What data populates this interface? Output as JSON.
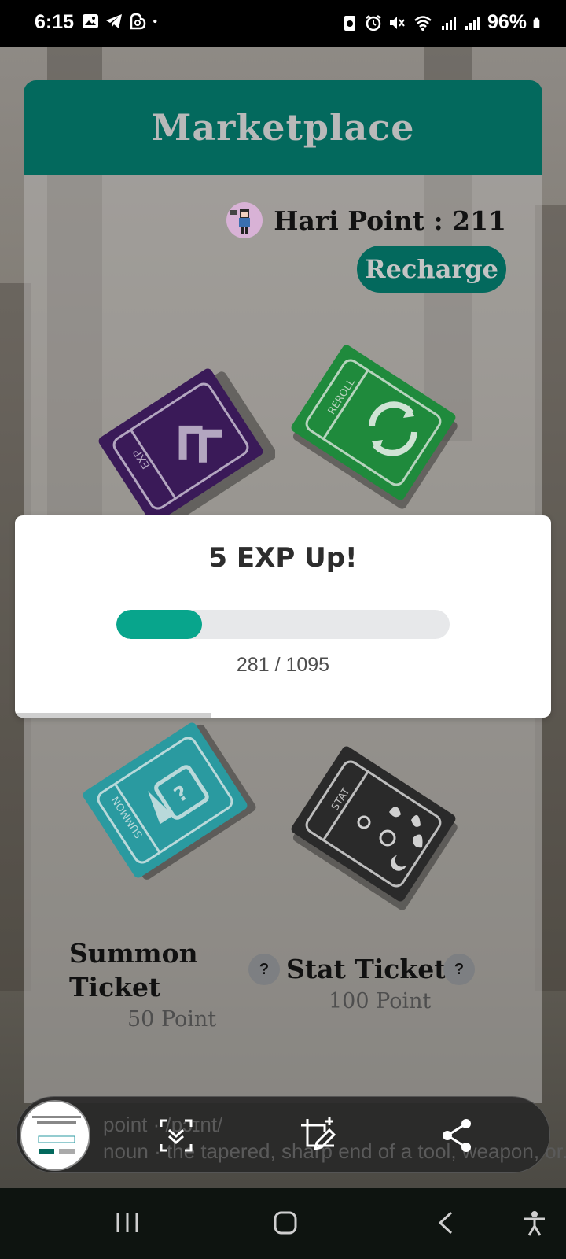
{
  "status_bar": {
    "time": "6:15",
    "battery": "96%"
  },
  "marketplace": {
    "title": "Marketplace",
    "points_label": "Hari Point : 211",
    "recharge_label": "Recharge"
  },
  "tickets": [
    {
      "type": "EXP",
      "color": "#3a1a58"
    },
    {
      "type": "REROLL",
      "color": "#1f8a3c"
    },
    {
      "type": "SUMMON",
      "color": "#2a9aa0",
      "name": "Summon Ticket",
      "name_line1": "Summon",
      "name_line2": "Ticket",
      "price": "50 Point"
    },
    {
      "type": "STAT",
      "color": "#2a2a2a",
      "name": "Stat Ticket",
      "price": "100 Point"
    }
  ],
  "help_label": "?",
  "modal": {
    "title": "5 EXP Up!",
    "progress_text": "281 / 1095",
    "progress_current": 281,
    "progress_max": 1095
  },
  "screenshot_bar": {
    "line1": "point · /pɔɪnt/",
    "line2": "noun · the tapered, sharp end of a tool, weapon, or..."
  },
  "colors": {
    "accent": "#03695d",
    "progress": "#08a58c"
  }
}
